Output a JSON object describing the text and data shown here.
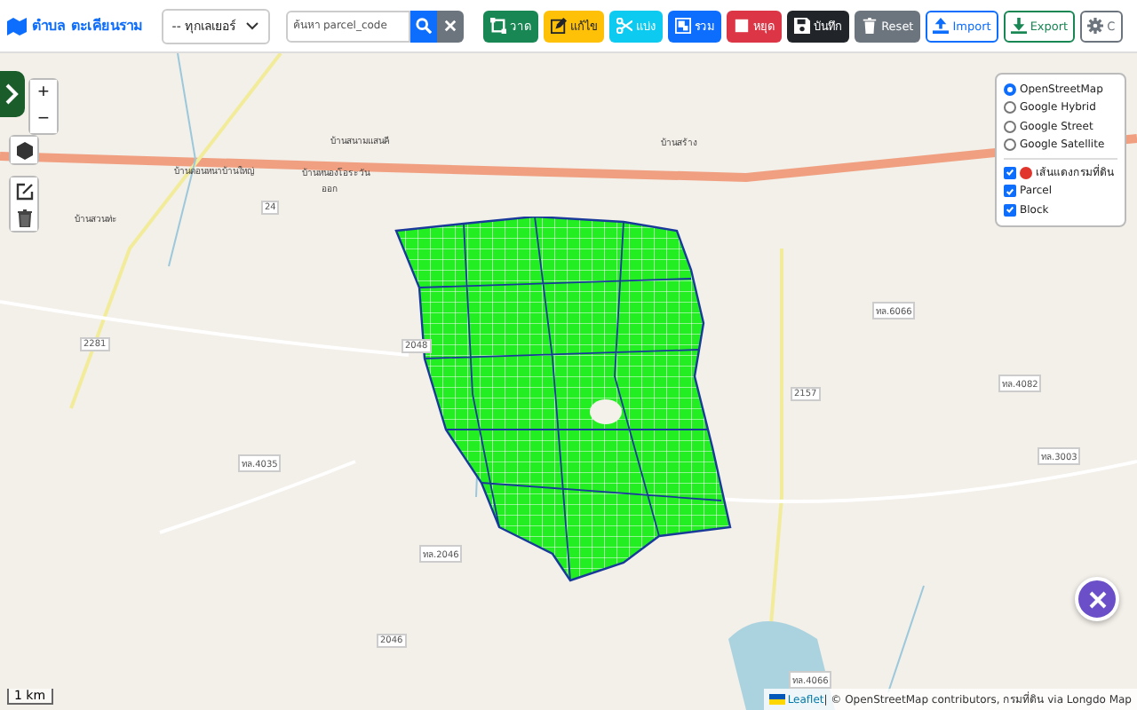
{
  "header": {
    "title": "ตำบล ตะเคียนราม",
    "layer_select": "-- ทุกเลเยอร์",
    "search": {
      "placeholder": "ค้นหา parcel_code"
    }
  },
  "buttons": [
    {
      "kind": "draw",
      "label": "วาด"
    },
    {
      "kind": "edit",
      "label": "แก้ไข"
    },
    {
      "kind": "split",
      "label": "แบ่ง"
    },
    {
      "kind": "merge",
      "label": "รวม"
    },
    {
      "kind": "stop",
      "label": "หยุด"
    },
    {
      "kind": "save",
      "label": "บันทึก"
    },
    {
      "kind": "reset",
      "label": "Reset"
    },
    {
      "kind": "import",
      "label": "Import"
    },
    {
      "kind": "export",
      "label": "Export"
    },
    {
      "kind": "settings",
      "label": "C"
    }
  ],
  "map": {
    "zoom": [
      "+",
      "−"
    ],
    "labels": [
      {
        "kind": "road",
        "text": "24"
      },
      {
        "kind": "road",
        "text": "2281"
      },
      {
        "kind": "road",
        "text": "2048"
      },
      {
        "kind": "road",
        "text": "ทล.4035"
      },
      {
        "kind": "road",
        "text": "ทล.2046"
      },
      {
        "kind": "road",
        "text": "2046"
      },
      {
        "kind": "road",
        "text": "2157"
      },
      {
        "kind": "road",
        "text": "ทล.6066"
      },
      {
        "kind": "road",
        "text": "ทล.4082"
      },
      {
        "kind": "road",
        "text": "ทล.3003"
      },
      {
        "kind": "road",
        "text": "ทล.4066"
      },
      {
        "kind": "place",
        "text": "บ้านดอนหนาบ้านใหญ่"
      },
      {
        "kind": "place",
        "text": "บ้านสนามแสนคี"
      },
      {
        "kind": "place",
        "text": "บ้านหนองโอระวัน"
      },
      {
        "kind": "place",
        "text": "ออก"
      },
      {
        "kind": "place",
        "text": "บ้านสวนท่ะ"
      },
      {
        "kind": "place",
        "text": "บ้านสร้าง"
      }
    ],
    "layers": {
      "base": [
        {
          "label": "OpenStreetMap",
          "selected": true
        },
        {
          "label": "Google Hybrid",
          "selected": false
        },
        {
          "label": "Google Street",
          "selected": false
        },
        {
          "label": "Google Satellite",
          "selected": false
        }
      ],
      "overlays": [
        {
          "label": "เส้นแดงกรมที่ดิน",
          "checked": true,
          "color": "#e0342c"
        },
        {
          "label": "Parcel",
          "checked": true
        },
        {
          "label": "Block",
          "checked": true
        }
      ]
    },
    "scale": "1 km",
    "attribution": {
      "link": "Leaflet",
      "text": "| © OpenStreetMap contributors, กรมที่ดิน via Longdo Map"
    }
  }
}
